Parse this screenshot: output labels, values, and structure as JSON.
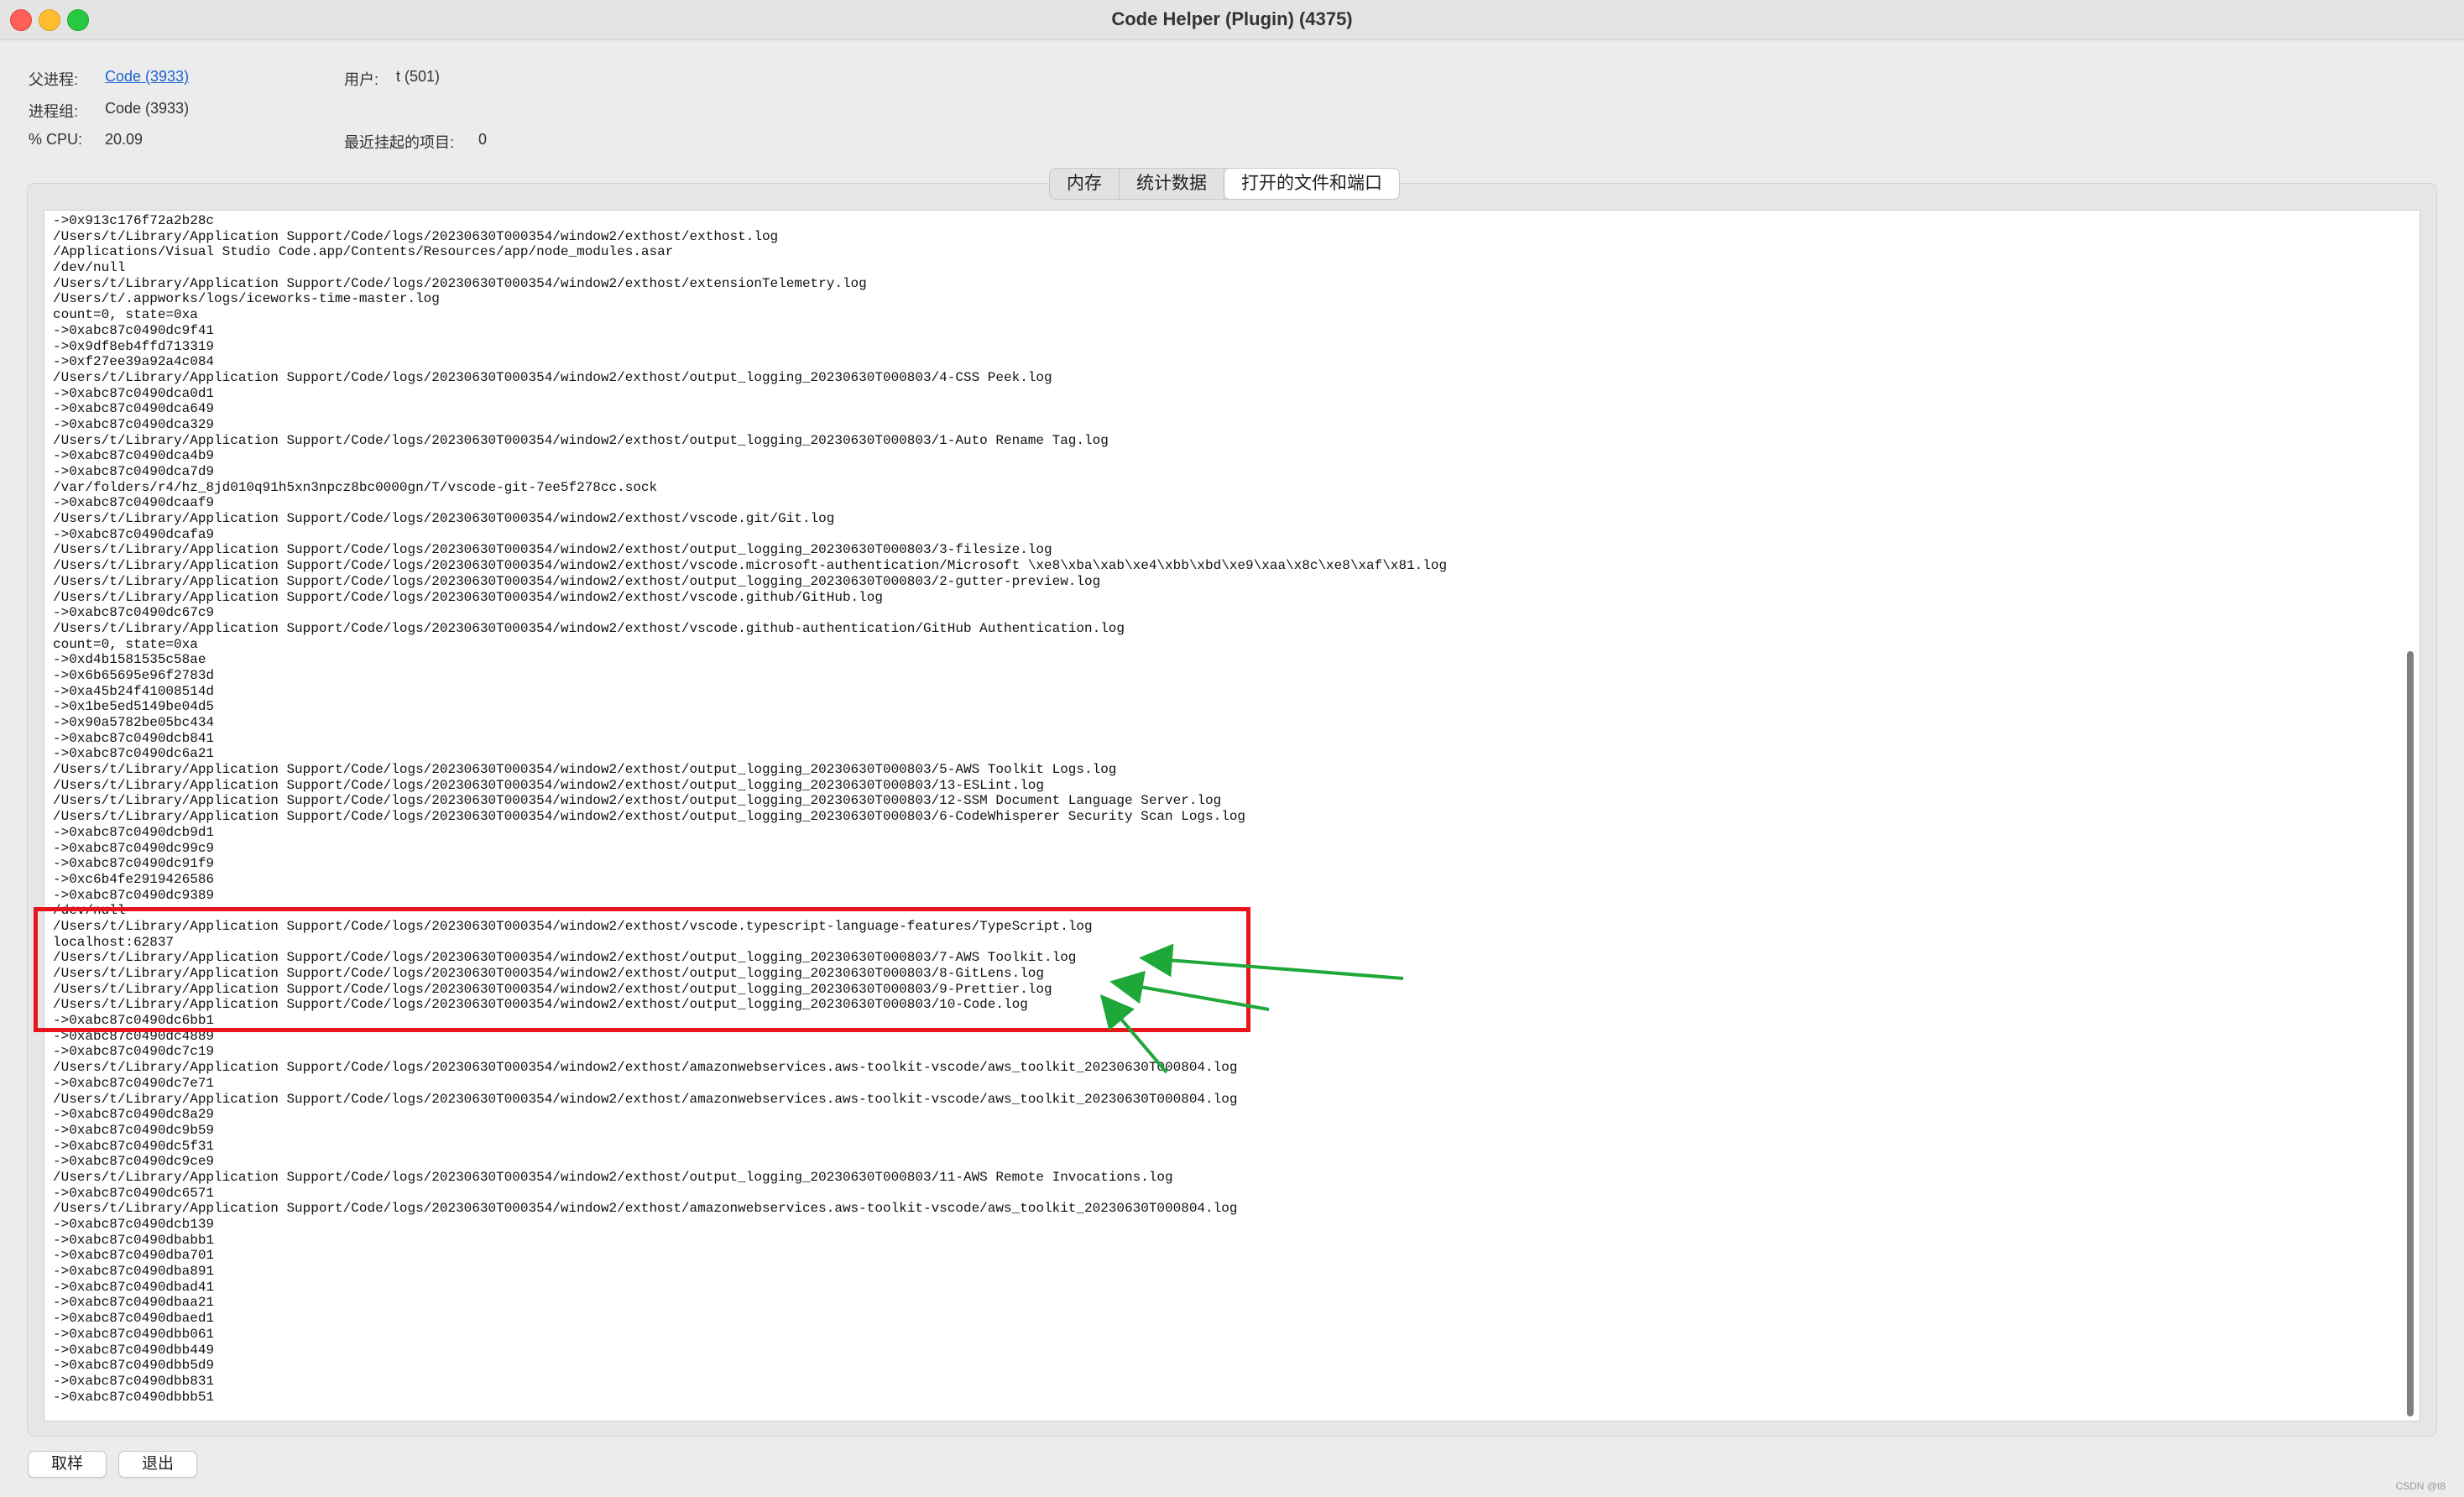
{
  "window": {
    "title": "Code Helper (Plugin) (4375)"
  },
  "info": {
    "parent_label": "父进程:",
    "parent_value": "Code (3933)",
    "user_label": "用户:",
    "user_value": "t (501)",
    "group_label": "进程组:",
    "group_value": "Code (3933)",
    "cpu_label": "% CPU:",
    "cpu_value": "20.09",
    "hang_label": "最近挂起的项目:",
    "hang_value": "0"
  },
  "tabs": [
    "内存",
    "统计数据",
    "打开的文件和端口"
  ],
  "active_tab": "打开的文件和端口",
  "log_lines": [
    "->0x913c176f72a2b28c",
    "/Users/t/Library/Application Support/Code/logs/20230630T000354/window2/exthost/exthost.log",
    "/Applications/Visual Studio Code.app/Contents/Resources/app/node_modules.asar",
    "/dev/null",
    "/Users/t/Library/Application Support/Code/logs/20230630T000354/window2/exthost/extensionTelemetry.log",
    "/Users/t/.appworks/logs/iceworks-time-master.log",
    "count=0, state=0xa",
    "->0xabc87c0490dc9f41",
    "->0x9df8eb4ffd713319",
    "->0xf27ee39a92a4c084",
    "/Users/t/Library/Application Support/Code/logs/20230630T000354/window2/exthost/output_logging_20230630T000803/4-CSS Peek.log",
    "->0xabc87c0490dca0d1",
    "->0xabc87c0490dca649",
    "->0xabc87c0490dca329",
    "/Users/t/Library/Application Support/Code/logs/20230630T000354/window2/exthost/output_logging_20230630T000803/1-Auto Rename Tag.log",
    "->0xabc87c0490dca4b9",
    "->0xabc87c0490dca7d9",
    "/var/folders/r4/hz_8jd010q91h5xn3npcz8bc0000gn/T/vscode-git-7ee5f278cc.sock",
    "->0xabc87c0490dcaaf9",
    "/Users/t/Library/Application Support/Code/logs/20230630T000354/window2/exthost/vscode.git/Git.log",
    "->0xabc87c0490dcafa9",
    "/Users/t/Library/Application Support/Code/logs/20230630T000354/window2/exthost/output_logging_20230630T000803/3-filesize.log",
    "/Users/t/Library/Application Support/Code/logs/20230630T000354/window2/exthost/vscode.microsoft-authentication/Microsoft \\xe8\\xba\\xab\\xe4\\xbb\\xbd\\xe9\\xaa\\x8c\\xe8\\xaf\\x81.log",
    "/Users/t/Library/Application Support/Code/logs/20230630T000354/window2/exthost/output_logging_20230630T000803/2-gutter-preview.log",
    "/Users/t/Library/Application Support/Code/logs/20230630T000354/window2/exthost/vscode.github/GitHub.log",
    "->0xabc87c0490dc67c9",
    "/Users/t/Library/Application Support/Code/logs/20230630T000354/window2/exthost/vscode.github-authentication/GitHub Authentication.log",
    "count=0, state=0xa",
    "->0xd4b1581535c58ae",
    "->0x6b65695e96f2783d",
    "->0xa45b24f41008514d",
    "->0x1be5ed5149be04d5",
    "->0x90a5782be05bc434",
    "->0xabc87c0490dcb841",
    "->0xabc87c0490dc6a21",
    "/Users/t/Library/Application Support/Code/logs/20230630T000354/window2/exthost/output_logging_20230630T000803/5-AWS Toolkit Logs.log",
    "/Users/t/Library/Application Support/Code/logs/20230630T000354/window2/exthost/output_logging_20230630T000803/13-ESLint.log",
    "/Users/t/Library/Application Support/Code/logs/20230630T000354/window2/exthost/output_logging_20230630T000803/12-SSM Document Language Server.log",
    "/Users/t/Library/Application Support/Code/logs/20230630T000354/window2/exthost/output_logging_20230630T000803/6-CodeWhisperer Security Scan Logs.log",
    "->0xabc87c0490dcb9d1",
    "->0xabc87c0490dc99c9",
    "->0xabc87c0490dc91f9",
    "->0xc6b4fe2919426586",
    "->0xabc87c0490dc9389",
    "/dev/null",
    "/Users/t/Library/Application Support/Code/logs/20230630T000354/window2/exthost/vscode.typescript-language-features/TypeScript.log",
    "localhost:62837",
    "/Users/t/Library/Application Support/Code/logs/20230630T000354/window2/exthost/output_logging_20230630T000803/7-AWS Toolkit.log",
    "/Users/t/Library/Application Support/Code/logs/20230630T000354/window2/exthost/output_logging_20230630T000803/8-GitLens.log",
    "/Users/t/Library/Application Support/Code/logs/20230630T000354/window2/exthost/output_logging_20230630T000803/9-Prettier.log",
    "/Users/t/Library/Application Support/Code/logs/20230630T000354/window2/exthost/output_logging_20230630T000803/10-Code.log",
    "->0xabc87c0490dc6bb1",
    "->0xabc87c0490dc4889",
    "->0xabc87c0490dc7c19",
    "/Users/t/Library/Application Support/Code/logs/20230630T000354/window2/exthost/amazonwebservices.aws-toolkit-vscode/aws_toolkit_20230630T000804.log",
    "->0xabc87c0490dc7e71",
    "/Users/t/Library/Application Support/Code/logs/20230630T000354/window2/exthost/amazonwebservices.aws-toolkit-vscode/aws_toolkit_20230630T000804.log",
    "->0xabc87c0490dc8a29",
    "->0xabc87c0490dc9b59",
    "->0xabc87c0490dc5f31",
    "->0xabc87c0490dc9ce9",
    "/Users/t/Library/Application Support/Code/logs/20230630T000354/window2/exthost/output_logging_20230630T000803/11-AWS Remote Invocations.log",
    "->0xabc87c0490dc6571",
    "/Users/t/Library/Application Support/Code/logs/20230630T000354/window2/exthost/amazonwebservices.aws-toolkit-vscode/aws_toolkit_20230630T000804.log",
    "->0xabc87c0490dcb139",
    "->0xabc87c0490dbabb1",
    "->0xabc87c0490dba701",
    "->0xabc87c0490dba891",
    "->0xabc87c0490dbad41",
    "->0xabc87c0490dbaa21",
    "->0xabc87c0490dbaed1",
    "->0xabc87c0490dbb061",
    "->0xabc87c0490dbb449",
    "->0xabc87c0490dbb5d9",
    "->0xabc87c0490dbb831",
    "->0xabc87c0490dbbb51"
  ],
  "buttons": {
    "sample": "取样",
    "quit": "退出"
  },
  "watermark": "CSDN @t8",
  "colors": {
    "highlight_box": "#e8141c",
    "arrows": "#1fa83a",
    "link": "#1a64d0"
  }
}
